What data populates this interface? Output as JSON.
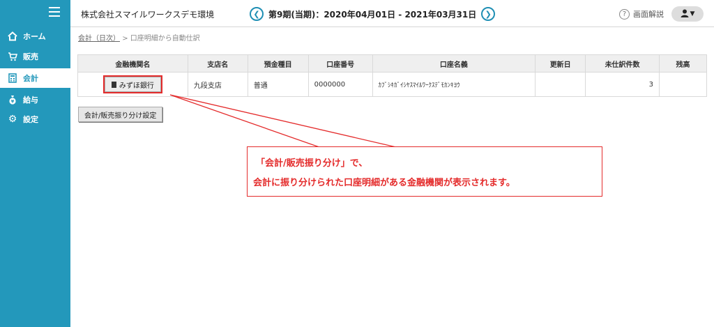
{
  "sidebar": {
    "items": [
      {
        "label": "ホーム",
        "icon": "home-icon"
      },
      {
        "label": "販売",
        "icon": "cart-icon"
      },
      {
        "label": "会計",
        "icon": "calculator-icon"
      },
      {
        "label": "給与",
        "icon": "money-bag-icon"
      },
      {
        "label": "設定",
        "icon": "gear-icon"
      }
    ],
    "active": "会計"
  },
  "header": {
    "company": "株式会社スマイルワークスデモ環境",
    "period": "第9期(当期)：2020年04月01日 - 2021年03月31日",
    "help_label": "画面解説"
  },
  "breadcrumb": {
    "link": "会計（日次）",
    "separator": ">",
    "current": "口座明細から自動仕訳"
  },
  "table": {
    "headers": [
      "金融機関名",
      "支店名",
      "預金種目",
      "口座番号",
      "口座名義",
      "更新日",
      "未仕訳件数",
      "残高"
    ],
    "rows": [
      {
        "bank": "みずほ銀行",
        "branch": "九段支店",
        "type": "普通",
        "number": "0000000",
        "holder": "ｶﾌﾞｼｷｶﾞｲｼﾔｽﾏｲﾙﾜｰｸｽﾃﾞﾓｶﾝｷﾖｳ",
        "updated": "",
        "unprocessed": "3",
        "balance": ""
      }
    ]
  },
  "buttons": {
    "setting": "会計/販売振り分け設定"
  },
  "callout": {
    "line1": "「会計/販売振り分け」で、",
    "line2": "会計に振り分けられた口座明細がある金融機関が表示されます。"
  },
  "colors": {
    "sidebar": "#2398bb",
    "accent": "#1f8fb4",
    "annotation": "#e42b2b"
  }
}
